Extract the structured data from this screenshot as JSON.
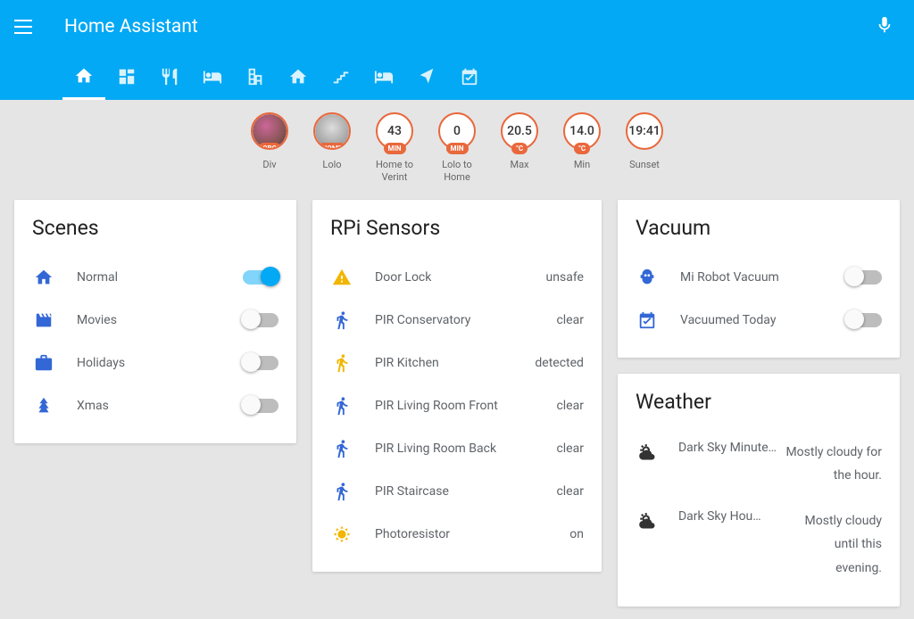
{
  "app": {
    "title": "Home Assistant"
  },
  "tabs": [
    {
      "name": "home-icon"
    },
    {
      "name": "dashboard-icon"
    },
    {
      "name": "kitchen-icon"
    },
    {
      "name": "bed-icon"
    },
    {
      "name": "office-icon"
    },
    {
      "name": "house-alt-icon"
    },
    {
      "name": "stairs-icon"
    },
    {
      "name": "bed2-icon"
    },
    {
      "name": "pin-icon"
    },
    {
      "name": "calendar-check-icon"
    }
  ],
  "badges": [
    {
      "value": "",
      "chip": "CBC",
      "label": "Div",
      "avatar": true,
      "avatarVariant": "a"
    },
    {
      "value": "",
      "chip": "HOME",
      "label": "Lolo",
      "avatar": true,
      "avatarVariant": "b"
    },
    {
      "value": "43",
      "chip": "MIN",
      "label": "Home to Verint"
    },
    {
      "value": "0",
      "chip": "MIN",
      "label": "Lolo to Home"
    },
    {
      "value": "20.5",
      "chip": "°C",
      "label": "Max"
    },
    {
      "value": "14.0",
      "chip": "°C",
      "label": "Min"
    },
    {
      "value": "19:41",
      "chip": "",
      "label": "Sunset"
    }
  ],
  "scenes": {
    "title": "Scenes",
    "items": [
      {
        "icon": "home",
        "label": "Normal",
        "on": true
      },
      {
        "icon": "movies",
        "label": "Movies",
        "on": false
      },
      {
        "icon": "holidays",
        "label": "Holidays",
        "on": false
      },
      {
        "icon": "xmas",
        "label": "Xmas",
        "on": false
      }
    ]
  },
  "sensors": {
    "title": "RPi Sensors",
    "items": [
      {
        "icon": "alert",
        "label": "Door Lock",
        "value": "unsafe",
        "warn": true
      },
      {
        "icon": "walk",
        "label": "PIR Conservatory",
        "value": "clear"
      },
      {
        "icon": "run",
        "label": "PIR Kitchen",
        "value": "detected",
        "warn": true
      },
      {
        "icon": "walk",
        "label": "PIR Living Room Front",
        "value": "clear"
      },
      {
        "icon": "walk",
        "label": "PIR Living Room Back",
        "value": "clear"
      },
      {
        "icon": "walk",
        "label": "PIR Staircase",
        "value": "clear"
      },
      {
        "icon": "bright",
        "label": "Photoresistor",
        "value": "on",
        "warn": true
      }
    ]
  },
  "vacuum": {
    "title": "Vacuum",
    "items": [
      {
        "icon": "robot",
        "label": "Mi Robot Vacuum",
        "toggle": true,
        "on": false
      },
      {
        "icon": "cal-check",
        "label": "Vacuumed Today",
        "toggle": true,
        "on": false
      }
    ]
  },
  "weather": {
    "title": "Weather",
    "items": [
      {
        "label": "Dark Sky Minute…",
        "value": "Mostly cloudy for the hour."
      },
      {
        "label": "Dark Sky Hou…",
        "value": "Mostly cloudy until this evening."
      }
    ]
  }
}
